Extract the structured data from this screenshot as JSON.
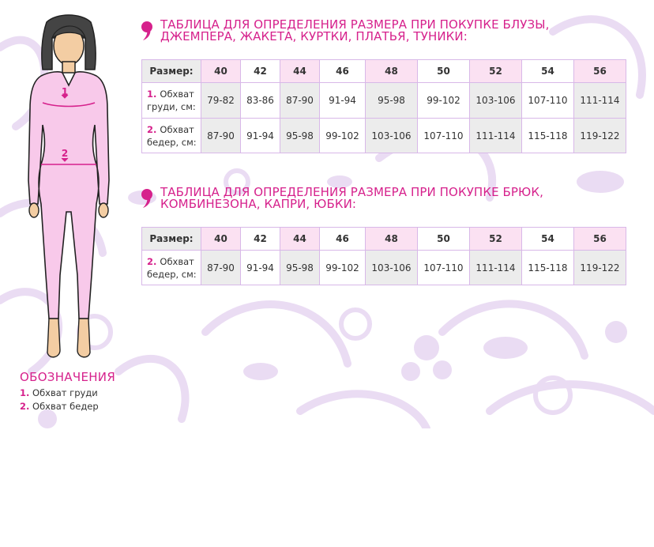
{
  "section1": {
    "title_line1": "ТАБЛИЦА ДЛЯ ОПРЕДЕЛЕНИЯ РАЗМЕРА ПРИ ПОКУПКЕ БЛУЗЫ,",
    "title_line2": "ДЖЕМПЕРА, ЖАКЕТА, КУРТКИ, ПЛАТЬЯ, ТУНИКИ:",
    "header_label": "Размер:",
    "sizes": [
      "40",
      "42",
      "44",
      "46",
      "48",
      "50",
      "52",
      "54",
      "56"
    ],
    "rows": [
      {
        "num": "1.",
        "label_a": "Обхват",
        "label_b": "груди, см:",
        "values": [
          "79-82",
          "83-86",
          "87-90",
          "91-94",
          "95-98",
          "99-102",
          "103-106",
          "107-110",
          "111-114"
        ]
      },
      {
        "num": "2.",
        "label_a": "Обхват",
        "label_b": "бедер, см:",
        "values": [
          "87-90",
          "91-94",
          "95-98",
          "99-102",
          "103-106",
          "107-110",
          "111-114",
          "115-118",
          "119-122"
        ]
      }
    ]
  },
  "section2": {
    "title_line1": "ТАБЛИЦА ДЛЯ ОПРЕДЕЛЕНИЯ РАЗМЕРА ПРИ ПОКУПКЕ БРЮК,",
    "title_line2": "КОМБИНЕЗОНА, КАПРИ, ЮБКИ:",
    "header_label": "Размер:",
    "sizes": [
      "40",
      "42",
      "44",
      "46",
      "48",
      "50",
      "52",
      "54",
      "56"
    ],
    "rows": [
      {
        "num": "2.",
        "label_a": "Обхват",
        "label_b": "бедер, см:",
        "values": [
          "87-90",
          "91-94",
          "95-98",
          "99-102",
          "103-106",
          "107-110",
          "111-114",
          "115-118",
          "119-122"
        ]
      }
    ]
  },
  "figure": {
    "mark1": "1",
    "mark2": "2"
  },
  "legend": {
    "title": "ОБОЗНАЧЕНИЯ",
    "items": [
      {
        "num": "1.",
        "text": "Обхват груди"
      },
      {
        "num": "2.",
        "text": "Обхват бедер"
      }
    ]
  },
  "colors": {
    "accent": "#d6218c",
    "header_pink": "#fbe1f2",
    "cell_grey": "#ececec",
    "border": "#d8b8e8",
    "deco": "#eadcf3"
  }
}
